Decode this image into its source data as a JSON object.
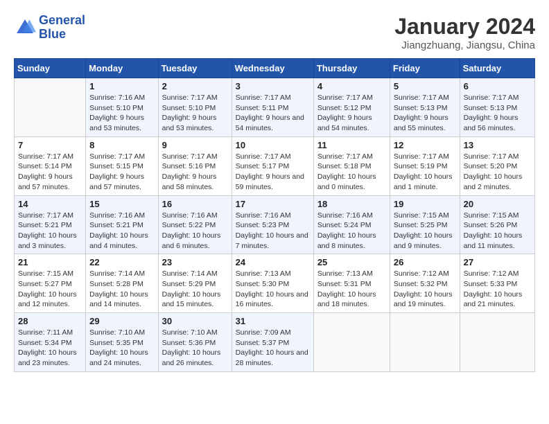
{
  "logo": {
    "line1": "General",
    "line2": "Blue"
  },
  "title": "January 2024",
  "location": "Jiangzhuang, Jiangsu, China",
  "days_of_week": [
    "Sunday",
    "Monday",
    "Tuesday",
    "Wednesday",
    "Thursday",
    "Friday",
    "Saturday"
  ],
  "weeks": [
    [
      {
        "day": "",
        "sunrise": "",
        "sunset": "",
        "daylight": ""
      },
      {
        "day": "1",
        "sunrise": "7:16 AM",
        "sunset": "5:10 PM",
        "daylight": "9 hours and 53 minutes."
      },
      {
        "day": "2",
        "sunrise": "7:17 AM",
        "sunset": "5:10 PM",
        "daylight": "9 hours and 53 minutes."
      },
      {
        "day": "3",
        "sunrise": "7:17 AM",
        "sunset": "5:11 PM",
        "daylight": "9 hours and 54 minutes."
      },
      {
        "day": "4",
        "sunrise": "7:17 AM",
        "sunset": "5:12 PM",
        "daylight": "9 hours and 54 minutes."
      },
      {
        "day": "5",
        "sunrise": "7:17 AM",
        "sunset": "5:13 PM",
        "daylight": "9 hours and 55 minutes."
      },
      {
        "day": "6",
        "sunrise": "7:17 AM",
        "sunset": "5:13 PM",
        "daylight": "9 hours and 56 minutes."
      }
    ],
    [
      {
        "day": "7",
        "sunrise": "7:17 AM",
        "sunset": "5:14 PM",
        "daylight": "9 hours and 57 minutes."
      },
      {
        "day": "8",
        "sunrise": "7:17 AM",
        "sunset": "5:15 PM",
        "daylight": "9 hours and 57 minutes."
      },
      {
        "day": "9",
        "sunrise": "7:17 AM",
        "sunset": "5:16 PM",
        "daylight": "9 hours and 58 minutes."
      },
      {
        "day": "10",
        "sunrise": "7:17 AM",
        "sunset": "5:17 PM",
        "daylight": "9 hours and 59 minutes."
      },
      {
        "day": "11",
        "sunrise": "7:17 AM",
        "sunset": "5:18 PM",
        "daylight": "10 hours and 0 minutes."
      },
      {
        "day": "12",
        "sunrise": "7:17 AM",
        "sunset": "5:19 PM",
        "daylight": "10 hours and 1 minute."
      },
      {
        "day": "13",
        "sunrise": "7:17 AM",
        "sunset": "5:20 PM",
        "daylight": "10 hours and 2 minutes."
      }
    ],
    [
      {
        "day": "14",
        "sunrise": "7:17 AM",
        "sunset": "5:21 PM",
        "daylight": "10 hours and 3 minutes."
      },
      {
        "day": "15",
        "sunrise": "7:16 AM",
        "sunset": "5:21 PM",
        "daylight": "10 hours and 4 minutes."
      },
      {
        "day": "16",
        "sunrise": "7:16 AM",
        "sunset": "5:22 PM",
        "daylight": "10 hours and 6 minutes."
      },
      {
        "day": "17",
        "sunrise": "7:16 AM",
        "sunset": "5:23 PM",
        "daylight": "10 hours and 7 minutes."
      },
      {
        "day": "18",
        "sunrise": "7:16 AM",
        "sunset": "5:24 PM",
        "daylight": "10 hours and 8 minutes."
      },
      {
        "day": "19",
        "sunrise": "7:15 AM",
        "sunset": "5:25 PM",
        "daylight": "10 hours and 9 minutes."
      },
      {
        "day": "20",
        "sunrise": "7:15 AM",
        "sunset": "5:26 PM",
        "daylight": "10 hours and 11 minutes."
      }
    ],
    [
      {
        "day": "21",
        "sunrise": "7:15 AM",
        "sunset": "5:27 PM",
        "daylight": "10 hours and 12 minutes."
      },
      {
        "day": "22",
        "sunrise": "7:14 AM",
        "sunset": "5:28 PM",
        "daylight": "10 hours and 14 minutes."
      },
      {
        "day": "23",
        "sunrise": "7:14 AM",
        "sunset": "5:29 PM",
        "daylight": "10 hours and 15 minutes."
      },
      {
        "day": "24",
        "sunrise": "7:13 AM",
        "sunset": "5:30 PM",
        "daylight": "10 hours and 16 minutes."
      },
      {
        "day": "25",
        "sunrise": "7:13 AM",
        "sunset": "5:31 PM",
        "daylight": "10 hours and 18 minutes."
      },
      {
        "day": "26",
        "sunrise": "7:12 AM",
        "sunset": "5:32 PM",
        "daylight": "10 hours and 19 minutes."
      },
      {
        "day": "27",
        "sunrise": "7:12 AM",
        "sunset": "5:33 PM",
        "daylight": "10 hours and 21 minutes."
      }
    ],
    [
      {
        "day": "28",
        "sunrise": "7:11 AM",
        "sunset": "5:34 PM",
        "daylight": "10 hours and 23 minutes."
      },
      {
        "day": "29",
        "sunrise": "7:10 AM",
        "sunset": "5:35 PM",
        "daylight": "10 hours and 24 minutes."
      },
      {
        "day": "30",
        "sunrise": "7:10 AM",
        "sunset": "5:36 PM",
        "daylight": "10 hours and 26 minutes."
      },
      {
        "day": "31",
        "sunrise": "7:09 AM",
        "sunset": "5:37 PM",
        "daylight": "10 hours and 28 minutes."
      },
      {
        "day": "",
        "sunrise": "",
        "sunset": "",
        "daylight": ""
      },
      {
        "day": "",
        "sunrise": "",
        "sunset": "",
        "daylight": ""
      },
      {
        "day": "",
        "sunrise": "",
        "sunset": "",
        "daylight": ""
      }
    ]
  ]
}
